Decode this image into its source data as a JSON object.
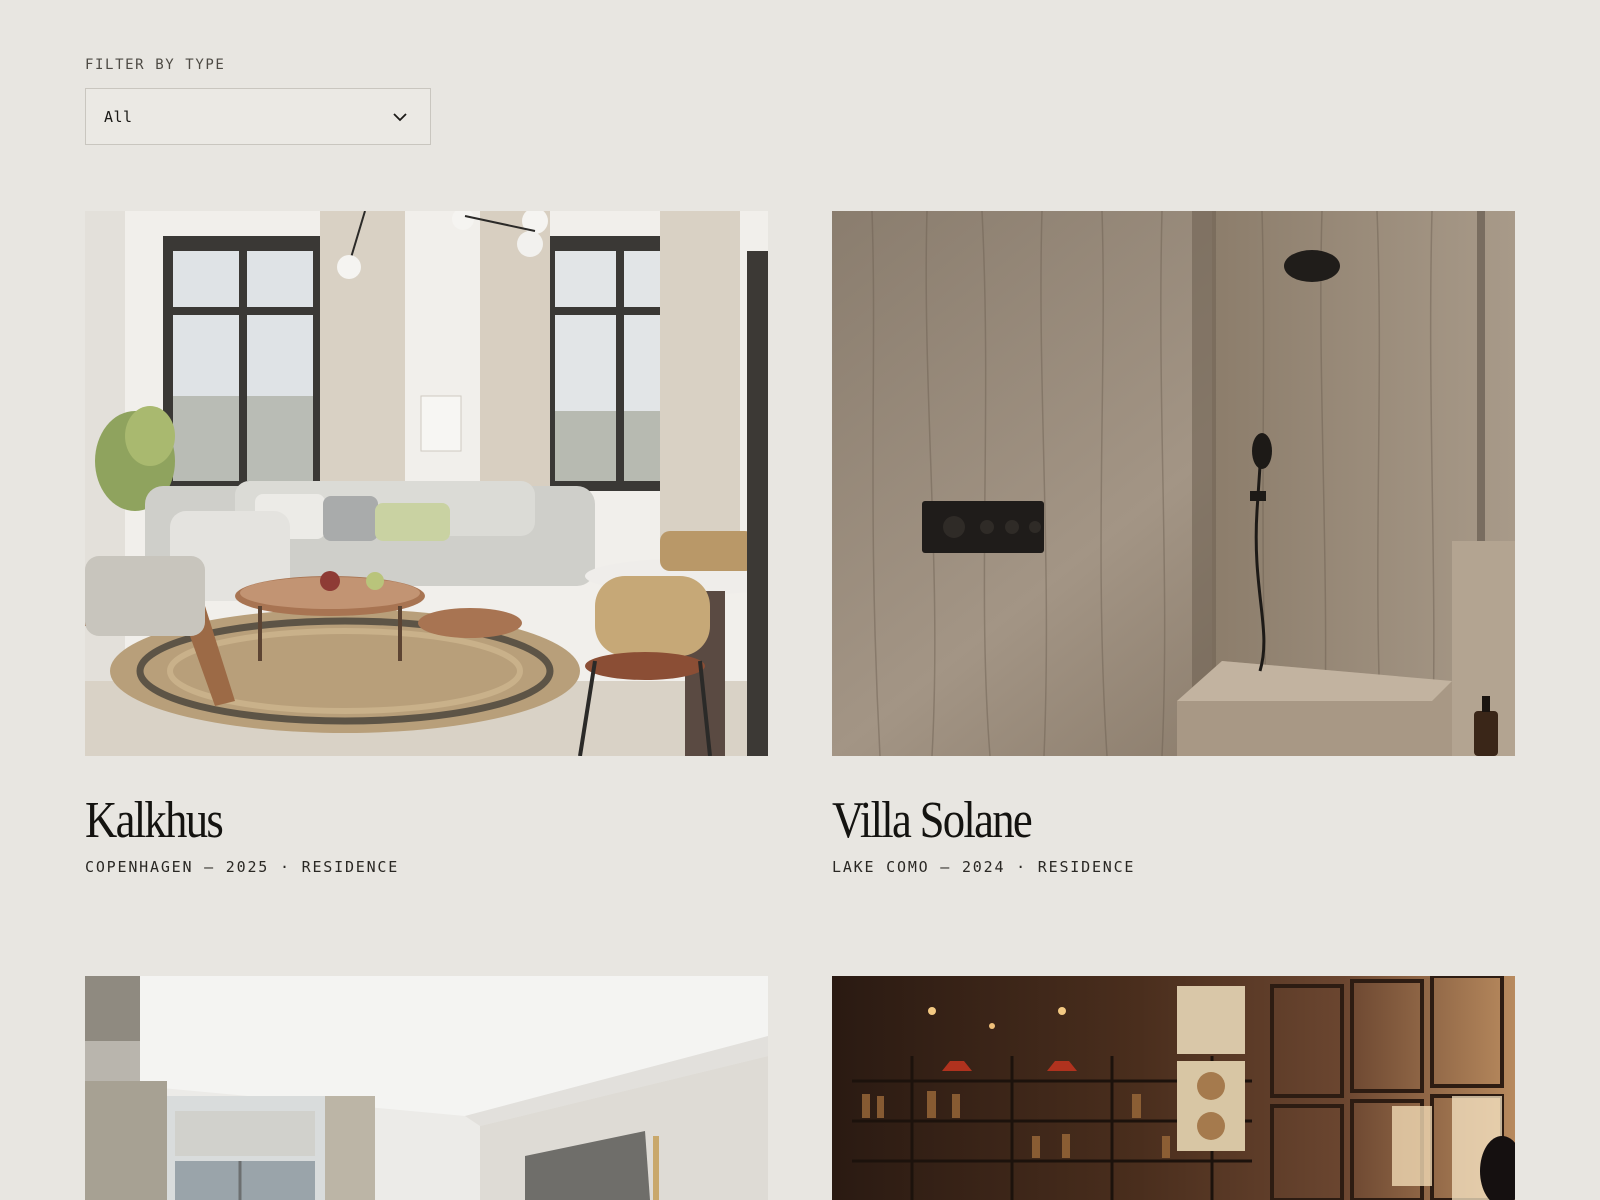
{
  "filter": {
    "label": "FILTER BY TYPE",
    "selected": "All",
    "icon": "chevron-down-icon"
  },
  "projects": [
    {
      "title": "Kalkhus",
      "meta": "COPENHAGEN — 2025 · RESIDENCE",
      "image": "living-room-photo"
    },
    {
      "title": "Villa Solane",
      "meta": "LAKE COMO — 2024 · RESIDENCE",
      "image": "stone-shower-photo"
    },
    {
      "title": "",
      "meta": "",
      "image": "bedroom-photo"
    },
    {
      "title": "",
      "meta": "",
      "image": "bar-interior-photo"
    }
  ]
}
